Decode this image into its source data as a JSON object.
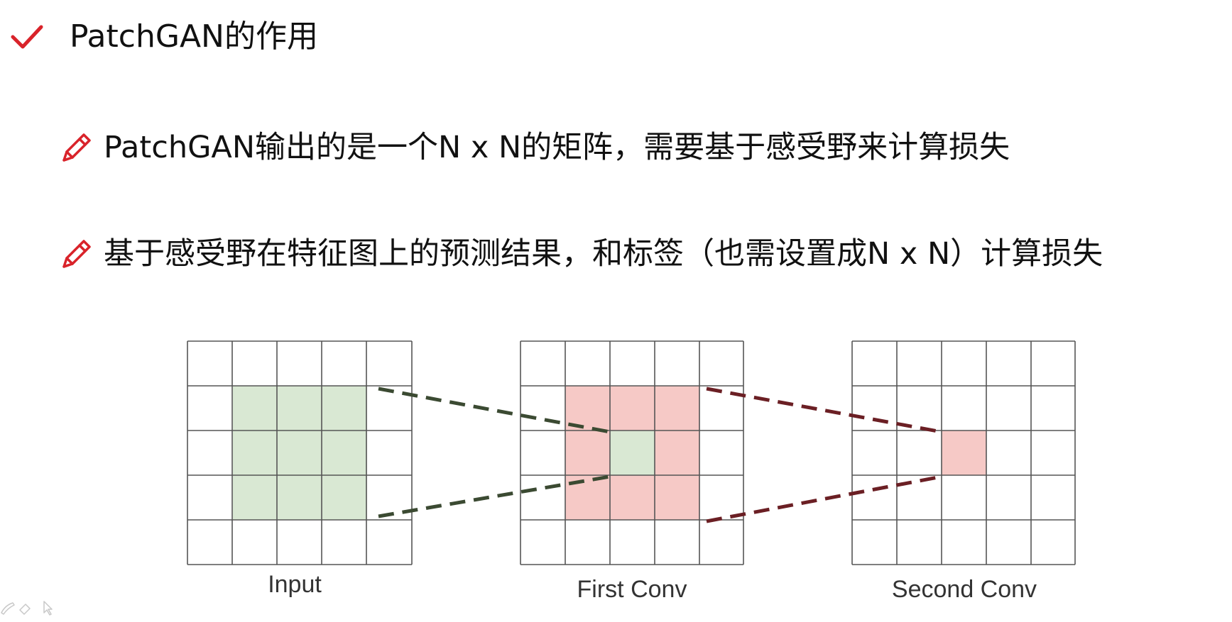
{
  "title": "PatchGAN的作用",
  "bullets": [
    "PatchGAN输出的是一个N x N的矩阵，需要基于感受野来计算损失",
    "基于感受野在特征图上的预测结果，和标签（也需设置成N x N）计算损失"
  ],
  "icons": {
    "title": "check-icon",
    "bullets": "pencil-icon",
    "toolbar": [
      "pen-tool-icon",
      "eraser-tool-icon",
      "pointer-tool-icon"
    ]
  },
  "colors": {
    "accent_red": "#d9232a",
    "green_fill": "#d9e8d3",
    "pink_fill": "#f6c9c6",
    "green_dash": "#3b4a32",
    "red_dash": "#6b1f24",
    "grid_line": "#555555"
  },
  "diagram": {
    "grid_size": 5,
    "panels": [
      {
        "label": "Input"
      },
      {
        "label": "First Conv"
      },
      {
        "label": "Second Conv"
      }
    ]
  }
}
